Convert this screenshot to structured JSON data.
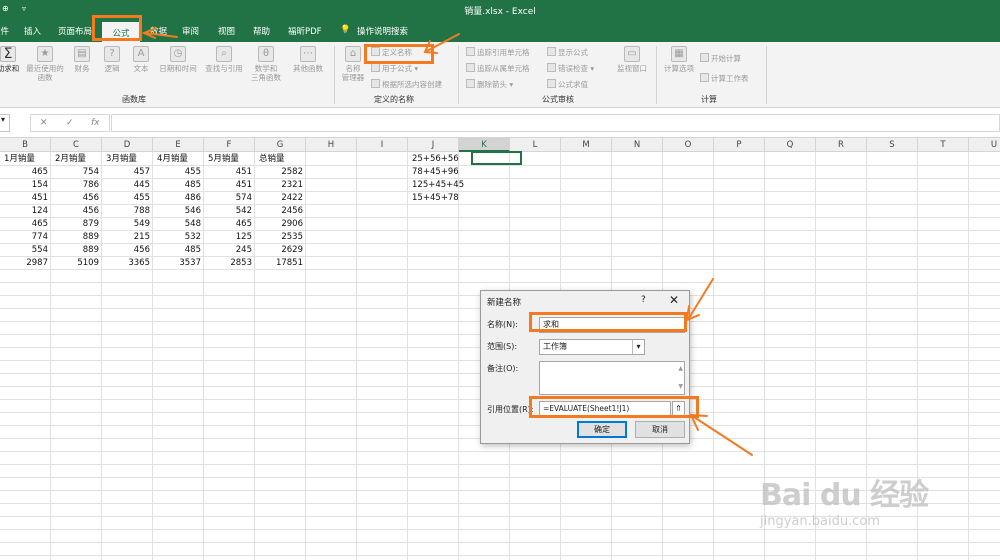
{
  "titlebar": {
    "title": "销量.xlsx  -  Excel",
    "left_glyph": "⊕",
    "undo_glyph": "▿"
  },
  "tabs": [
    {
      "label": "文件",
      "name": "tab-file"
    },
    {
      "label": "插入",
      "name": "tab-insert"
    },
    {
      "label": "页面布局",
      "name": "tab-page-layout"
    },
    {
      "label": "公式",
      "name": "tab-formulas",
      "active": true
    },
    {
      "label": "数据",
      "name": "tab-data"
    },
    {
      "label": "审阅",
      "name": "tab-review"
    },
    {
      "label": "视图",
      "name": "tab-view"
    },
    {
      "label": "帮助",
      "name": "tab-help"
    },
    {
      "label": "福昕PDF",
      "name": "tab-foxit-pdf"
    },
    {
      "label": "操作说明搜索",
      "name": "tab-tell-me"
    }
  ],
  "ribbon": {
    "autosum": "动求和",
    "recent": "最近使用的\n函数",
    "financial": "财务",
    "logical": "逻辑",
    "text": "文本",
    "datetime": "日期和时间",
    "lookup": "查找与引用",
    "math": "数学和\n三角函数",
    "more": "其他函数",
    "name_manager": "名称\n管理器",
    "define_name": "定义名称",
    "use_in_formula": "用于公式",
    "create_from_sel": "根据所选内容创建",
    "trace_precedents": "追踪引用单元格",
    "trace_dependents": "追踪从属单元格",
    "remove_arrows": "删除箭头",
    "show_formulas": "显示公式",
    "error_checking": "错误检查",
    "evaluate": "公式求值",
    "watch": "监视窗口",
    "calc_options": "计算选项",
    "calc_now": "开始计算",
    "calc_sheet": "计算工作表",
    "groups": {
      "functions": "函数库",
      "defined_names": "定义的名称",
      "auditing": "公式审核",
      "calculation": "计算"
    }
  },
  "formula_bar": {
    "cancel": "✕",
    "enter": "✓",
    "fx": "fx",
    "value": ""
  },
  "columns": [
    "B",
    "C",
    "D",
    "E",
    "F",
    "G",
    "H",
    "I",
    "J",
    "K",
    "L",
    "M",
    "N",
    "O",
    "P",
    "Q",
    "R",
    "S",
    "T",
    "U"
  ],
  "selected_column": "K",
  "sheet": {
    "headers": [
      "1月销量",
      "2月销量",
      "3月销量",
      "4月销量",
      "5月销量",
      "总销量"
    ],
    "rows": [
      [
        "465",
        "754",
        "457",
        "455",
        "451",
        "2582"
      ],
      [
        "154",
        "786",
        "445",
        "485",
        "451",
        "2321"
      ],
      [
        "451",
        "456",
        "455",
        "486",
        "574",
        "2422"
      ],
      [
        "124",
        "456",
        "788",
        "546",
        "542",
        "2456"
      ],
      [
        "465",
        "879",
        "549",
        "548",
        "465",
        "2906"
      ],
      [
        "774",
        "889",
        "215",
        "532",
        "125",
        "2535"
      ],
      [
        "554",
        "889",
        "456",
        "485",
        "245",
        "2629"
      ],
      [
        "2987",
        "5109",
        "3365",
        "3537",
        "2853",
        "17851"
      ]
    ],
    "col_j": [
      "25+56+56",
      "78+45+96",
      "125+45+45",
      "15+45+78"
    ]
  },
  "dialog": {
    "title": "新建名称",
    "help": "?",
    "close": "✕",
    "name_label": "名称(N):",
    "name_value": "求和",
    "scope_label": "范围(S):",
    "scope_value": "工作簿",
    "comment_label": "备注(O):",
    "ref_label": "引用位置(R):",
    "ref_value": "=EVALUATE(Sheet1!J1)",
    "ok": "确定",
    "cancel": "取消"
  },
  "watermark": {
    "line1": "Bai du 经验",
    "line2": "jingyan.baidu.com"
  },
  "colors": {
    "excel_green": "#217346",
    "annotation_orange": "#f47a20"
  }
}
